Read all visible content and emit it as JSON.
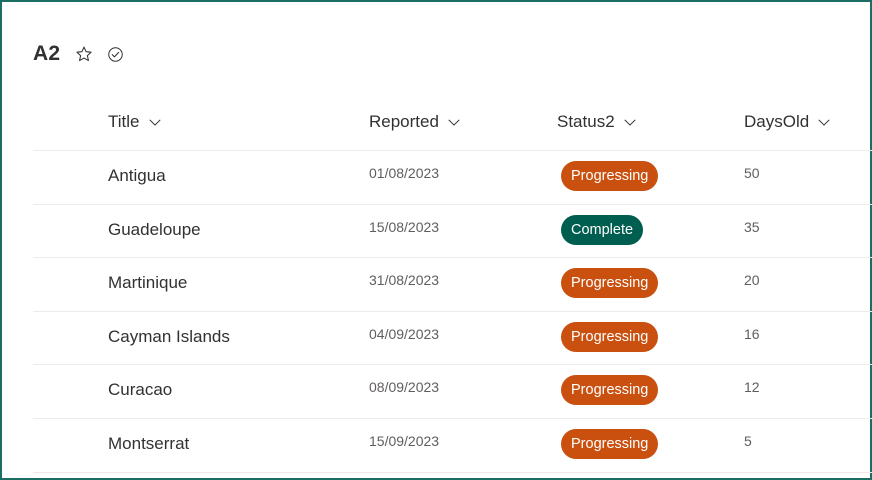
{
  "list": {
    "title": "A2",
    "favorite_icon": "star-outline-icon",
    "status_icon": "check-circle-icon"
  },
  "columns": {
    "title": "Title",
    "reported": "Reported",
    "status": "Status2",
    "days": "DaysOld"
  },
  "colors": {
    "progressing": "#ca5010",
    "complete": "#005e50",
    "frame": "#1b6e63"
  },
  "rows": [
    {
      "title": "Antigua",
      "reported": "01/08/2023",
      "status": "Progressing",
      "days": "50"
    },
    {
      "title": "Guadeloupe",
      "reported": "15/08/2023",
      "status": "Complete",
      "days": "35"
    },
    {
      "title": "Martinique",
      "reported": "31/08/2023",
      "status": "Progressing",
      "days": "20"
    },
    {
      "title": "Cayman Islands",
      "reported": "04/09/2023",
      "status": "Progressing",
      "days": "16"
    },
    {
      "title": "Curacao",
      "reported": "08/09/2023",
      "status": "Progressing",
      "days": "12"
    },
    {
      "title": "Montserrat",
      "reported": "15/09/2023",
      "status": "Progressing",
      "days": "5"
    }
  ]
}
